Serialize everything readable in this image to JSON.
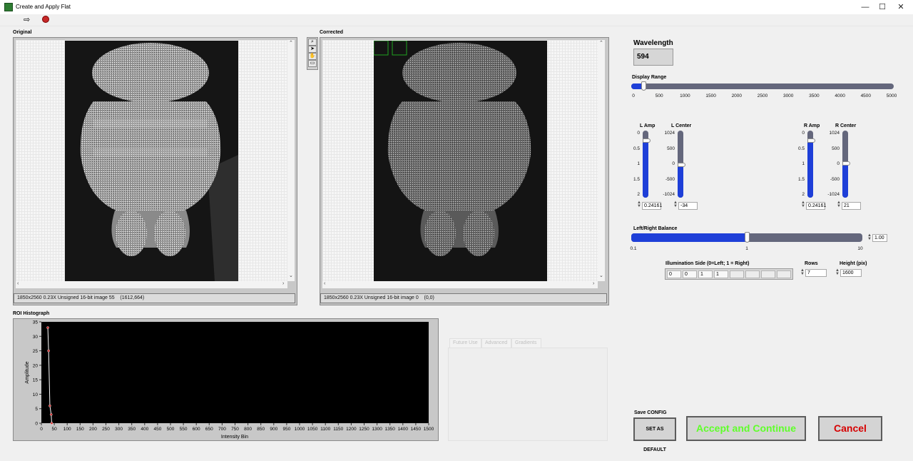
{
  "window": {
    "title": "Create and Apply Flat",
    "buttons": [
      "—",
      "☐",
      "✕"
    ]
  },
  "toolbar": {
    "run_glyph": "⇨"
  },
  "original": {
    "label": "Original",
    "status": "1850x2560 0.23X Unsigned 16-bit image 55    (1612,664)"
  },
  "corrected": {
    "label": "Corrected",
    "status": "1850x2560 0.23X Unsigned 16-bit image 0    (0,0)"
  },
  "histogram": {
    "label": "ROI Histograph",
    "ylabel": "Amplitude",
    "xlabel": "Intensity Bin"
  },
  "chart_data": {
    "type": "line",
    "title": "ROI Histograph",
    "xlabel": "Intensity Bin",
    "ylabel": "Amplitude",
    "xlim": [
      0,
      1500
    ],
    "ylim": [
      0,
      35
    ],
    "x_ticks": [
      "0",
      "50",
      "100",
      "150",
      "200",
      "250",
      "300",
      "350",
      "400",
      "450",
      "500",
      "550",
      "600",
      "650",
      "700",
      "750",
      "800",
      "850",
      "900",
      "950",
      "1000",
      "1050",
      "1100",
      "1150",
      "1200",
      "1250",
      "1300",
      "1350",
      "1400",
      "1450",
      "1500"
    ],
    "y_ticks": [
      "0",
      "5",
      "10",
      "15",
      "20",
      "25",
      "30",
      "35"
    ],
    "series": [
      {
        "points": [
          [
            25,
            33
          ],
          [
            28,
            25
          ],
          [
            33,
            6
          ],
          [
            38,
            3
          ],
          [
            40,
            0
          ]
        ]
      }
    ],
    "grid": false,
    "background": "#000000",
    "line_color": "#ffffff",
    "marker_color": "#d32f2f"
  },
  "tabs": [
    "Future Use",
    "Advanced",
    "Gradients"
  ],
  "wavelength": {
    "label": "Wavelength",
    "value": "594"
  },
  "display_range": {
    "label": "Display Range",
    "ticks": [
      "0",
      "500",
      "1000",
      "1500",
      "2000",
      "2500",
      "3000",
      "3500",
      "4000",
      "4500",
      "5000"
    ],
    "value": 200,
    "max": 5000
  },
  "l_amp": {
    "label": "L Amp",
    "ticks": [
      "0",
      "0.5",
      "1",
      "1.5",
      "2"
    ],
    "value_text": "0.24161",
    "value": 0.24161
  },
  "l_center": {
    "label": "L Center",
    "ticks": [
      "1024",
      "500",
      "0",
      "-500",
      "-1024"
    ],
    "value_text": "-34",
    "value": -34
  },
  "r_amp": {
    "label": "R Amp",
    "ticks": [
      "0",
      "0.5",
      "1",
      "1.5",
      "2"
    ],
    "value_text": "0.24161",
    "value": 0.24161
  },
  "r_center": {
    "label": "R Center",
    "ticks": [
      "1024",
      "500",
      "0",
      "-500",
      "-1024"
    ],
    "value_text": "21",
    "value": 21
  },
  "balance": {
    "label": "Left/Right Balance",
    "ticks": [
      "0.1",
      "1",
      "10"
    ],
    "value_text": "1.00",
    "value": 1.0
  },
  "illumination": {
    "label": "Illumination Side (0=Left; 1 = Right)",
    "values": [
      "0",
      "0",
      "1",
      "1",
      "",
      "",
      "",
      ""
    ]
  },
  "rows": {
    "label": "Rows",
    "value": "7"
  },
  "height": {
    "label": "Height (pix)",
    "value": "1600"
  },
  "save_config": {
    "label": "Save CONFIG",
    "button": "SET AS DEFAULT"
  },
  "accept_button": {
    "label": "Accept and Continue",
    "color": "#5fff2a"
  },
  "cancel_button": {
    "label": "Cancel",
    "color": "#d60000"
  },
  "colors": {
    "accent": "#1e3fd8",
    "track": "#64677c"
  }
}
